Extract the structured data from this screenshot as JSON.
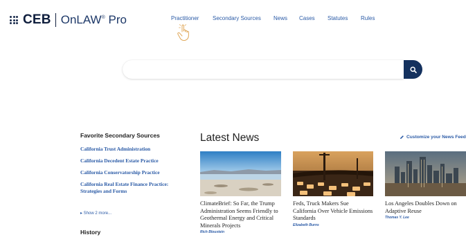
{
  "header": {
    "brand": "CEB",
    "product": "OnLAW",
    "product_suffix": "Pro",
    "registered": "®",
    "nav": [
      {
        "label": "Practitioner"
      },
      {
        "label": "Secondary Sources"
      },
      {
        "label": "News"
      },
      {
        "label": "Cases"
      },
      {
        "label": "Statutes"
      },
      {
        "label": "Rules"
      }
    ]
  },
  "search": {
    "placeholder": "",
    "value": "",
    "button_icon": "search-icon"
  },
  "favorites": {
    "title": "Favorite Secondary Sources",
    "items": [
      {
        "label": "California Trust Administration"
      },
      {
        "label": "California Decedent Estate Practice"
      },
      {
        "label": "California Conservatorship Practice"
      },
      {
        "label": "California Real Estate Finance Practice: Strategies and Forms"
      }
    ],
    "show_more": "▸ Show 2 more..."
  },
  "history": {
    "title": "History"
  },
  "news": {
    "title": "Latest News",
    "customize_label": "Customize your News Feed",
    "items": [
      {
        "headline": "ClimateBrief: So Far, the Trump Administration Seems Friendly to Geothermal Energy and Critical Minerals Projects",
        "author": "Rich Bloustein",
        "image": "desert-lake-photo"
      },
      {
        "headline": "Feds, Truck Makers Sue California Over Vehicle Emissions Standards",
        "author": "Elizabeth Burns",
        "image": "traffic-photo"
      },
      {
        "headline": "Los Angeles Doubles Down on Adaptive Reuse",
        "author": "Thomas Y. Lee",
        "image": "la-skyline-photo"
      }
    ]
  },
  "colors": {
    "link": "#2a5aa6",
    "brand_navy": "#14315e",
    "hand_icon": "#e0a85a"
  }
}
